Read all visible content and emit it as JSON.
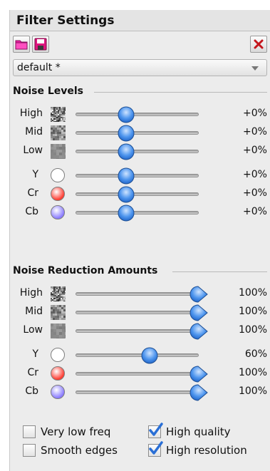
{
  "title": "Filter Settings",
  "toolbar": {
    "open_icon": "folder-icon",
    "save_icon": "save-disk-icon",
    "close_icon": "close-x-icon"
  },
  "preset": {
    "selected": "default *"
  },
  "noise_levels": {
    "heading": "Noise Levels",
    "rows": [
      {
        "label": "High",
        "value_text": "+0%",
        "position": 0.41
      },
      {
        "label": "Mid",
        "value_text": "+0%",
        "position": 0.41
      },
      {
        "label": "Low",
        "value_text": "+0%",
        "position": 0.41
      },
      {
        "label": "Y",
        "value_text": "+0%",
        "position": 0.41,
        "color": "#ffffff"
      },
      {
        "label": "Cr",
        "value_text": "+0%",
        "position": 0.41,
        "color": "#ff3b30"
      },
      {
        "label": "Cb",
        "value_text": "+0%",
        "position": 0.41,
        "color": "#8a7bff"
      }
    ]
  },
  "reduction": {
    "heading": "Noise Reduction Amounts",
    "rows": [
      {
        "label": "High",
        "value_text": "100%",
        "position": 1.0
      },
      {
        "label": "Mid",
        "value_text": "100%",
        "position": 1.0
      },
      {
        "label": "Low",
        "value_text": "100%",
        "position": 1.0
      },
      {
        "label": "Y",
        "value_text": "60%",
        "position": 0.6,
        "color": "#ffffff"
      },
      {
        "label": "Cr",
        "value_text": "100%",
        "position": 1.0,
        "color": "#ff3b30"
      },
      {
        "label": "Cb",
        "value_text": "100%",
        "position": 1.0,
        "color": "#8a7bff"
      }
    ]
  },
  "options": {
    "very_low_freq": {
      "label": "Very low freq",
      "checked": false
    },
    "high_quality": {
      "label": "High quality",
      "checked": true
    },
    "smooth_edges": {
      "label": "Smooth edges",
      "checked": false
    },
    "high_resolution": {
      "label": "High resolution",
      "checked": true
    }
  },
  "colors": {
    "accent_thumb": "#2f7de1",
    "checkmark": "#2a6fd6"
  }
}
